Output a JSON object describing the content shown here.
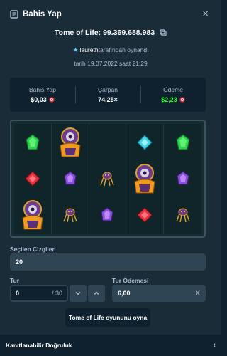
{
  "header": {
    "title": "Bahis Yap",
    "close": "×"
  },
  "bet": {
    "id": "Tome of Life: 99.369.688.983"
  },
  "player": {
    "username": "laureth",
    "suffix": "tarafından oynandı"
  },
  "date": "tarih 19.07.2022 saat 21:29",
  "stats": {
    "bet_label": "Bahis Yap",
    "bet_value": "$0,03",
    "multiplier_label": "Çarpan",
    "multiplier_value": "74,25×",
    "payout_label": "Ödeme",
    "payout_value": "$2,23"
  },
  "grid": {
    "rows": [
      [
        "green-gem",
        "big-book-top",
        "empty",
        "cyan-gem",
        "green-gem"
      ],
      [
        "red-gem",
        "purple-gem",
        "spider",
        "big-book-mid",
        "purple-gem"
      ],
      [
        "big-book-bottom",
        "spider",
        "purple-gem",
        "red-gem",
        "spider"
      ]
    ]
  },
  "form": {
    "lines_label": "Seçilen Çizgiler",
    "lines_value": "20",
    "rounds_label": "Tur",
    "rounds_value": "0",
    "rounds_total": "/ 30",
    "round_payout_label": "Tur Ödemesi",
    "round_payout_value": "6,00",
    "clear": "X"
  },
  "play_button": "Tome of Life oyununu oyna",
  "footer": {
    "label": "Kanıtlanabilir Doğruluk",
    "chevron": "‹"
  },
  "colors": {
    "accent_green": "#1fff20",
    "panel": "#1a2c38",
    "dark": "#0f212e",
    "coin_red": "#e8313f"
  }
}
